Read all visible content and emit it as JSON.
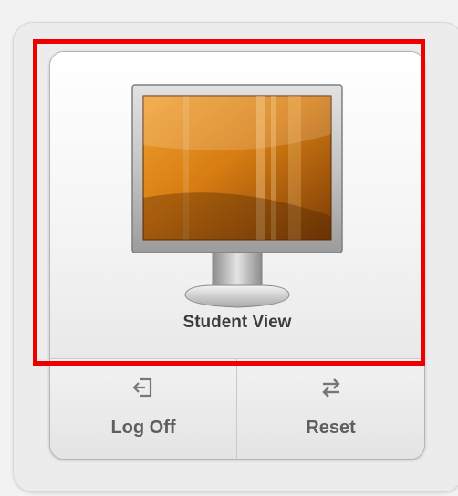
{
  "tile": {
    "main_button": {
      "label": "Student View",
      "icon": "monitor-icon"
    },
    "log_off": {
      "label": "Log Off",
      "icon": "log-off-icon"
    },
    "reset": {
      "label": "Reset",
      "icon": "swap-arrows-icon"
    }
  },
  "highlight": {
    "color": "#ee0000"
  }
}
